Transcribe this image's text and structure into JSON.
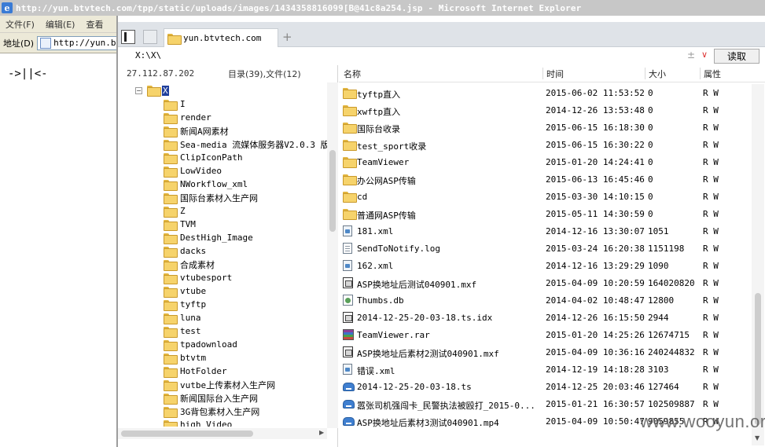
{
  "ie": {
    "title": "http://yun.btvtech.com/tpp/static/uploads/images/1434358816099[B@41c8a254.jsp - Microsoft Internet Explorer",
    "menu": [
      "文件(F)",
      "编辑(E)",
      "查看"
    ],
    "address_label": "地址(D)",
    "address_value": "http://yun.b",
    "page_text": "->||<-"
  },
  "fm": {
    "tab_label": "yun.btvtech.com",
    "new_tab": "+",
    "path": "X:\\X\\",
    "path_plus": "±",
    "read_button": "读取",
    "server_ip": "27.112.87.202",
    "dir_count": "目录(39),文件(12)",
    "tree": {
      "root_label": "X",
      "items": [
        "I",
        "render",
        "新闻A网素材",
        "Sea-media 流媒体服务器V2.0.3 版",
        "ClipIconPath",
        "LowVideo",
        "NWorkflow_xml",
        "国际台素材入生产网",
        "Z",
        "TVM",
        "DestHigh_Image",
        "dacks",
        "合成素材",
        "vtubesport",
        "vtube",
        "tyftp",
        "luna",
        "test",
        "tpadownload",
        "btvtm",
        "HotFolder",
        "vutbe上传素材入生产网",
        "新闻国际台入生产网",
        "3G背包素材入生产网",
        "high_Video"
      ]
    },
    "columns": {
      "name": "名称",
      "time": "时间",
      "size": "大小",
      "attr": "属性"
    },
    "files": [
      {
        "icon": "folder-icon",
        "name": "tyftp直入",
        "time": "2015-06-02 11:53:52",
        "size": "0",
        "attr": "R W"
      },
      {
        "icon": "folder-icon",
        "name": "xwftp直入",
        "time": "2014-12-26 13:53:48",
        "size": "0",
        "attr": "R W"
      },
      {
        "icon": "folder-icon",
        "name": "国际台收录",
        "time": "2015-06-15 16:18:30",
        "size": "0",
        "attr": "R W"
      },
      {
        "icon": "folder-icon",
        "name": "test_sport收录",
        "time": "2015-06-15 16:30:22",
        "size": "0",
        "attr": "R W"
      },
      {
        "icon": "folder-icon",
        "name": "TeamViewer",
        "time": "2015-01-20 14:24:41",
        "size": "0",
        "attr": "R W"
      },
      {
        "icon": "folder-icon",
        "name": "办公网ASP传输",
        "time": "2015-06-13 16:45:46",
        "size": "0",
        "attr": "R W"
      },
      {
        "icon": "folder-icon",
        "name": "cd",
        "time": "2015-03-30 14:10:15",
        "size": "0",
        "attr": "R W"
      },
      {
        "icon": "folder-icon",
        "name": "普通网ASP传输",
        "time": "2015-05-11 14:30:59",
        "size": "0",
        "attr": "R W"
      },
      {
        "icon": "xml-icon",
        "name": "181.xml",
        "time": "2014-12-16 13:30:07",
        "size": "1051",
        "attr": "R W"
      },
      {
        "icon": "doc-icon",
        "name": "SendToNotify.log",
        "time": "2015-03-24 16:20:38",
        "size": "1151198",
        "attr": "R W"
      },
      {
        "icon": "xml-icon",
        "name": "162.xml",
        "time": "2014-12-16 13:29:29",
        "size": "1090",
        "attr": "R W"
      },
      {
        "icon": "media-icon",
        "name": "ASP换地址后测试040901.mxf",
        "time": "2015-04-09 10:20:59",
        "size": "164020820",
        "attr": "R W"
      },
      {
        "icon": "db-icon",
        "name": "Thumbs.db",
        "time": "2014-04-02 10:48:47",
        "size": "12800",
        "attr": "R W"
      },
      {
        "icon": "media-icon",
        "name": "2014-12-25-20-03-18.ts.idx",
        "time": "2014-12-26 16:15:50",
        "size": "2944",
        "attr": "R W"
      },
      {
        "icon": "rar-icon",
        "name": "TeamViewer.rar",
        "time": "2015-01-20 14:25:26",
        "size": "12674715",
        "attr": "R W"
      },
      {
        "icon": "media-icon",
        "name": "ASP换地址后素材2测试040901.mxf",
        "time": "2015-04-09 10:36:16",
        "size": "240244832",
        "attr": "R W"
      },
      {
        "icon": "xml-icon",
        "name": "错误.xml",
        "time": "2014-12-19 14:18:28",
        "size": "3103",
        "attr": "R W"
      },
      {
        "icon": "drive-icon",
        "name": "2014-12-25-20-03-18.ts",
        "time": "2014-12-25 20:03:46",
        "size": "127464",
        "attr": "R W"
      },
      {
        "icon": "drive-icon",
        "name": "嚣张司机强闯卡_民警执法被殴打_2015-0...",
        "time": "2015-01-21 16:30:57",
        "size": "102509887",
        "attr": "R W"
      },
      {
        "icon": "drive-icon",
        "name": "ASP换地址后素材3测试040901.mp4",
        "time": "2015-04-09 10:50:47",
        "size": "9059855",
        "attr": "R W"
      }
    ]
  },
  "watermark": "www.wooyun.org"
}
